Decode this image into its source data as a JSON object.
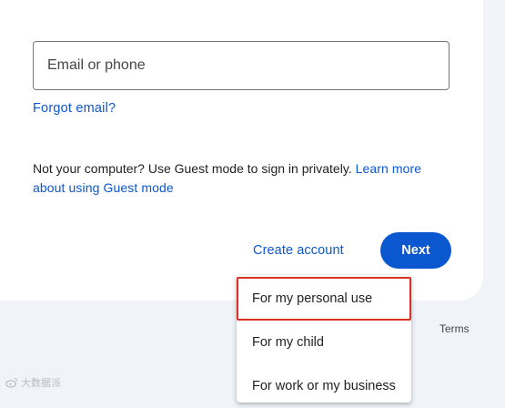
{
  "form": {
    "email_placeholder": "Email or phone",
    "forgot_email": "Forgot email?"
  },
  "guest_notice": {
    "text": "Not your computer? Use Guest mode to sign in privately. ",
    "link": "Learn more about using Guest mode"
  },
  "actions": {
    "create_account": "Create account",
    "next": "Next"
  },
  "create_account_menu": {
    "items": [
      {
        "label": "For my personal use",
        "highlighted": true
      },
      {
        "label": "For my child",
        "highlighted": false
      },
      {
        "label": "For work or my business",
        "highlighted": false
      }
    ]
  },
  "footer": {
    "terms": "Terms"
  },
  "watermark": {
    "text": "大数据派"
  },
  "colors": {
    "accent": "#0b57d0",
    "highlight_box": "#d93025",
    "page_background": "#f0f4f9"
  }
}
